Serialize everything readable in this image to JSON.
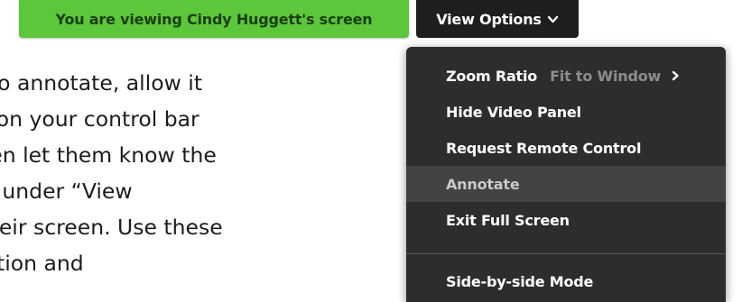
{
  "banner": {
    "viewing_text": "You are viewing Cindy Huggett's screen",
    "view_options_label": "View Options",
    "view_options_icon": "chevron-down-icon"
  },
  "colors": {
    "banner_green": "#5cc73a",
    "menu_background": "#2d2d2d",
    "highlight_background": "#434343"
  },
  "body_text": {
    "lines": [
      "ts to annotate, allow it",
      "on on your control bar",
      "Then let them know the",
      "ble under “View",
      "f their screen. Use these",
      "raction and"
    ]
  },
  "menu": {
    "zoom_ratio_label": "Zoom Ratio",
    "zoom_ratio_value": "Fit to Window",
    "zoom_ratio_icon": "chevron-right-icon",
    "hide_video_panel": "Hide Video Panel",
    "request_remote_control": "Request Remote Control",
    "annotate": "Annotate",
    "exit_full_screen": "Exit Full Screen",
    "side_by_side_mode": "Side-by-side Mode",
    "highlighted_item": "Annotate"
  }
}
